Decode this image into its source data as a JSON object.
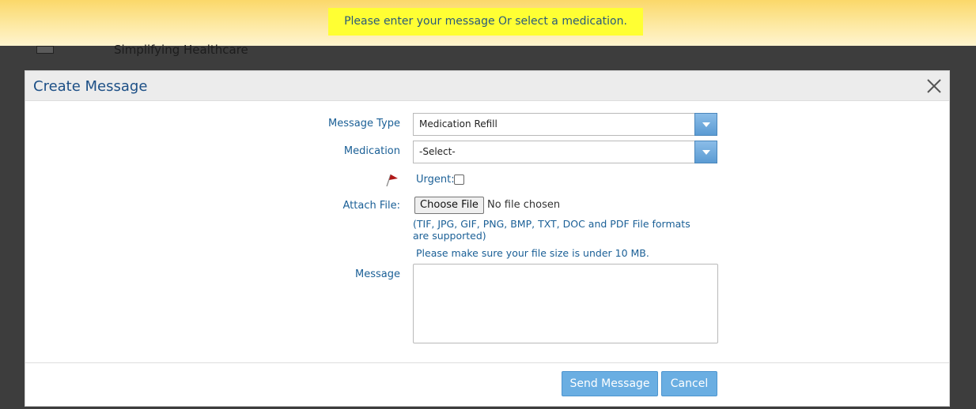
{
  "notification": {
    "message": "Please enter your message Or select a medication."
  },
  "background": {
    "tagline": "Simplifying Healthcare"
  },
  "modal": {
    "title": "Create Message",
    "close_icon": "close-icon"
  },
  "form": {
    "message_type_label": "Message Type",
    "message_type_value": "Medication Refill",
    "medication_label": "Medication",
    "medication_value": "-Select-",
    "urgent_label": "Urgent:",
    "urgent_checked": false,
    "urgent_icon": "flag-icon",
    "attach_label": "Attach File:",
    "choose_file_label": "Choose File",
    "file_status": "No file chosen",
    "formats_note": "(TIF, JPG, GIF, PNG, BMP, TXT, DOC and PDF File formats are supported)",
    "size_note": "Please make sure your file size is under 10 MB.",
    "message_label": "Message",
    "message_value": ""
  },
  "footer": {
    "send_label": "Send Message",
    "cancel_label": "Cancel"
  },
  "colors": {
    "notify_highlight": "#ffff33",
    "button": "#6aaee2",
    "label_text": "#1a5f96"
  }
}
